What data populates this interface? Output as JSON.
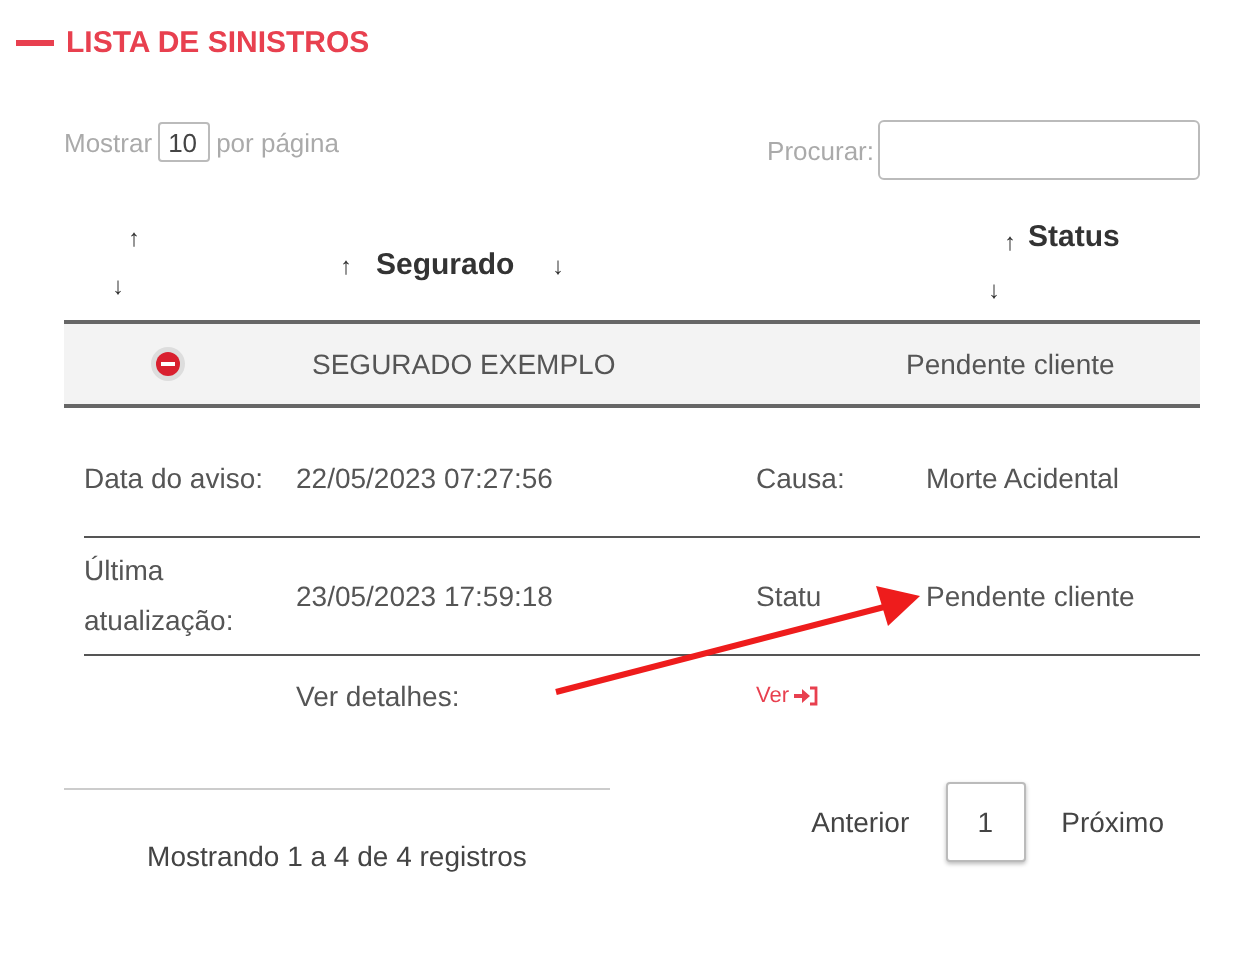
{
  "title": "LISTA DE SINISTROS",
  "length": {
    "label_before": "Mostrar",
    "value": "10",
    "label_after": "por página"
  },
  "search": {
    "label": "Procurar:"
  },
  "columns": [
    {
      "sort_up": "↑",
      "sort_down": "↓"
    },
    {
      "sort_up": "↑",
      "label": "Segurado",
      "sort_down": "↓"
    },
    {
      "sort_up": "↑",
      "label": "Status",
      "sort_down": "↓"
    }
  ],
  "rows": [
    {
      "expanded": true,
      "segurado": "SEGURADO EXEMPLO",
      "status": "Pendente cliente",
      "details": [
        {
          "label": "Data do aviso:",
          "value": "22/05/2023 07:27:56",
          "label_2": "Causa:",
          "value_2": "Morte Acidental"
        },
        {
          "label": "Última atualização:",
          "value": "23/05/2023 17:59:18",
          "label_2": "Statu",
          "value_2": "Pendente cliente"
        }
      ],
      "details_label": "Ver detalhes:",
      "details_link": "Ver"
    }
  ],
  "info": "Mostrando 1 a 4 de 4 registros",
  "pagination": {
    "previous": "Anterior",
    "pages": [
      {
        "label": "1",
        "selected": true
      }
    ],
    "next": "Próximo"
  }
}
